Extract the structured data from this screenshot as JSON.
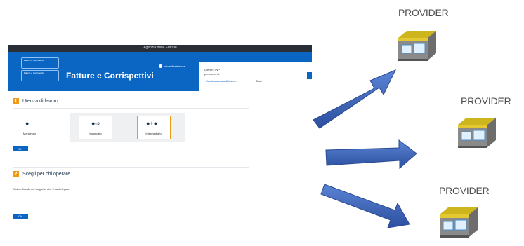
{
  "screenshot": {
    "top_bar_text": "Agenzia delle Entrate",
    "logo_top_line_1": "Fatture e Corrispettivi",
    "logo_top_line_2": "Fatture e Corrispettivi",
    "app_title": "Fatture e Corrispettivi",
    "help_link": "Info e Assistenza",
    "user_line_1": "Utente: TNP",
    "user_line_2": "per conto di:",
    "change_link": "Cambia utenza di lavoro",
    "logout_link": "Esci",
    "section1": {
      "number": "1",
      "title": "Utenza di lavoro"
    },
    "options": [
      {
        "label": "Me stesso"
      },
      {
        "label": "Incaricato"
      },
      {
        "label": "Intermediario"
      }
    ],
    "ok_label": "OK",
    "section2": {
      "number": "2",
      "title": "Scegli per chi operare"
    },
    "cf_label": "Codice fiscale del soggetto che ti ha delegato",
    "colors": {
      "header": "#0b66c3",
      "accent": "#f09b17",
      "arrow": "#3a62b5"
    }
  },
  "providers": [
    {
      "label": "PROVIDER"
    },
    {
      "label": "PROVIDER"
    },
    {
      "label": "PROVIDER"
    }
  ]
}
